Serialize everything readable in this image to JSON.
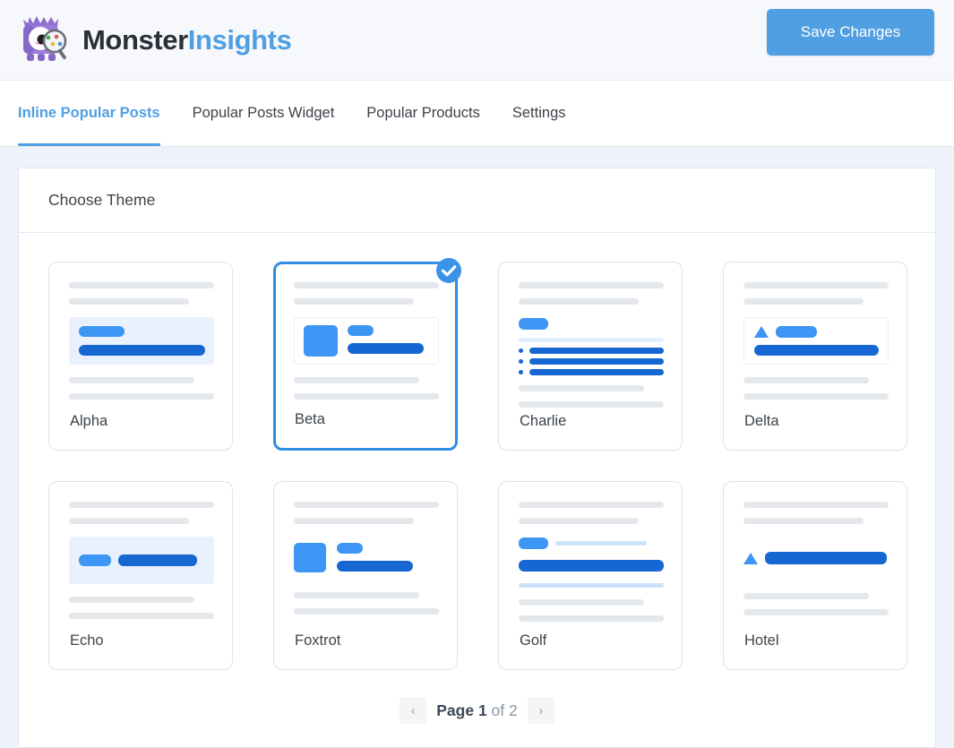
{
  "header": {
    "brand_primary": "Monster",
    "brand_secondary": "Insights",
    "logo_icon": "monster-mascot-icon",
    "save_label": "Save Changes",
    "accent_color": "#509fe2"
  },
  "tabs": [
    {
      "label": "Inline Popular Posts",
      "active": true
    },
    {
      "label": "Popular Posts Widget",
      "active": false
    },
    {
      "label": "Popular Products",
      "active": false
    },
    {
      "label": "Settings",
      "active": false
    }
  ],
  "panel": {
    "title": "Choose Theme"
  },
  "themes": [
    {
      "name": "Alpha",
      "selected": false,
      "layout": "alpha"
    },
    {
      "name": "Beta",
      "selected": true,
      "layout": "beta",
      "badge_icon": "check-circle-icon"
    },
    {
      "name": "Charlie",
      "selected": false,
      "layout": "charlie"
    },
    {
      "name": "Delta",
      "selected": false,
      "layout": "delta"
    },
    {
      "name": "Echo",
      "selected": false,
      "layout": "echo"
    },
    {
      "name": "Foxtrot",
      "selected": false,
      "layout": "foxtrot"
    },
    {
      "name": "Golf",
      "selected": false,
      "layout": "golf"
    },
    {
      "name": "Hotel",
      "selected": false,
      "layout": "hotel"
    }
  ],
  "pagination": {
    "prev_icon": "chevron-left-icon",
    "next_icon": "chevron-right-icon",
    "label_prefix": "Page",
    "current_page": "1",
    "label_middle": "of",
    "total_pages": "2"
  },
  "colors": {
    "blue_dark": "#1667d2",
    "blue_light": "#3d95f4",
    "blue_pale": "#cbe2fb",
    "grey_bar": "#e4e7ec",
    "selected_border": "#2f8de4"
  }
}
